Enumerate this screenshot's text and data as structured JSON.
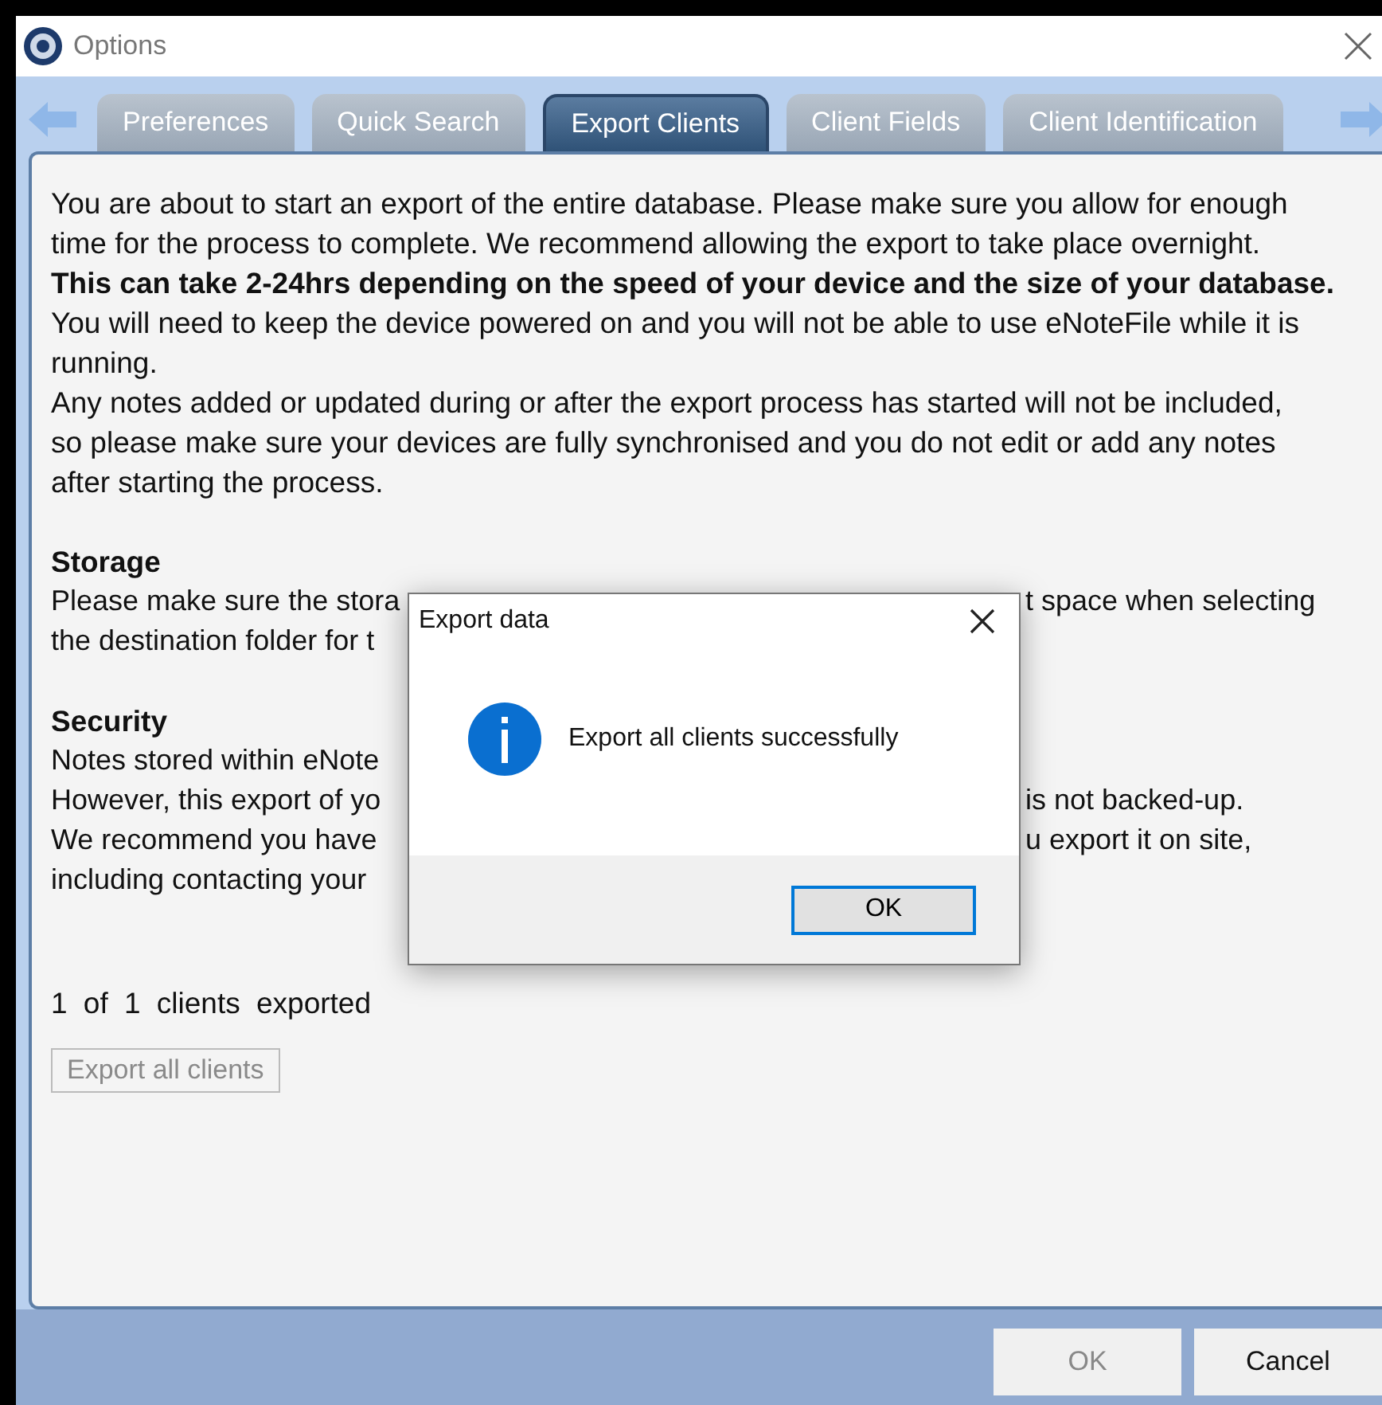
{
  "window": {
    "title": "Options"
  },
  "tabs": [
    {
      "label": "Preferences",
      "selected": false
    },
    {
      "label": "Quick Search",
      "selected": false
    },
    {
      "label": "Export Clients",
      "selected": true
    },
    {
      "label": "Client Fields",
      "selected": false
    },
    {
      "label": "Client Identification",
      "selected": false
    }
  ],
  "panel": {
    "paragraphs": [
      {
        "text": "You are about to start an export of the entire database. Please make sure you allow for enough time for the process to complete. We recommend allowing the export to take place overnight.",
        "bold": false
      },
      {
        "text": "This can take 2-24hrs depending on the speed of your device and the size of your database.",
        "bold": true
      },
      {
        "text": "You will need to keep the device powered on and you will not be able to use eNoteFile while it is running.",
        "bold": false
      },
      {
        "text": "Any notes added or updated during or after the export process has started will not be included, so please make sure your devices are fully synchronised and you do not edit or add any notes after starting the process.",
        "bold": false
      }
    ],
    "sections": [
      {
        "heading": "Storage",
        "lines": [
          {
            "left": "Please make sure the stora",
            "right": "t space when selecting"
          },
          {
            "left": "the destination folder for t"
          }
        ]
      },
      {
        "heading": "Security",
        "lines": [
          {
            "left": "Notes stored within eNote"
          },
          {
            "left": "However, this export of yo",
            "right": "is not backed-up."
          },
          {
            "left": "We recommend you have",
            "right": "u export it on site,"
          },
          {
            "left": "including contacting your"
          }
        ]
      }
    ],
    "progress": "1 of 1 clients exported",
    "export_button": {
      "label": "Export all clients",
      "disabled": true
    }
  },
  "buttons": [
    {
      "label": "OK",
      "disabled": true
    },
    {
      "label": "Cancel",
      "disabled": false
    }
  ],
  "dialog": {
    "title": "Export data",
    "message": "Export all clients successfully",
    "button": {
      "label": "OK",
      "focused": true
    }
  }
}
